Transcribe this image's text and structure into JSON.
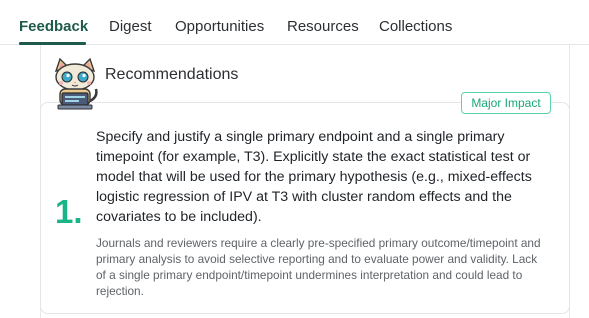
{
  "tabs": [
    {
      "label": "Feedback",
      "active": true
    },
    {
      "label": "Digest",
      "active": false
    },
    {
      "label": "Opportunities",
      "active": false
    },
    {
      "label": "Resources",
      "active": false
    },
    {
      "label": "Collections",
      "active": false
    }
  ],
  "section": {
    "title": "Recommendations",
    "mascot_icon": "cat-mascot-icon"
  },
  "recommendation": {
    "number": "1.",
    "badge": "Major Impact",
    "headline": "Specify and justify a single primary endpoint and a single primary timepoint (for example, T3). Explicitly state the exact statistical test or model that will be used for the primary hypothesis (e.g., mixed-effects logistic regression of IPV at T3 with cluster random effects and the covariates to be included).",
    "body": "Journals and reviewers require a clearly pre-specified primary outcome/timepoint and primary analysis to avoid selective reporting and to evaluate power and validity. Lack of a single primary endpoint/timepoint undermines interpretation and could lead to rejection."
  },
  "colors": {
    "accent": "#1f5b4c",
    "number": "#19b586",
    "badge_border": "#5ad3ad",
    "badge_text": "#19a67a"
  }
}
